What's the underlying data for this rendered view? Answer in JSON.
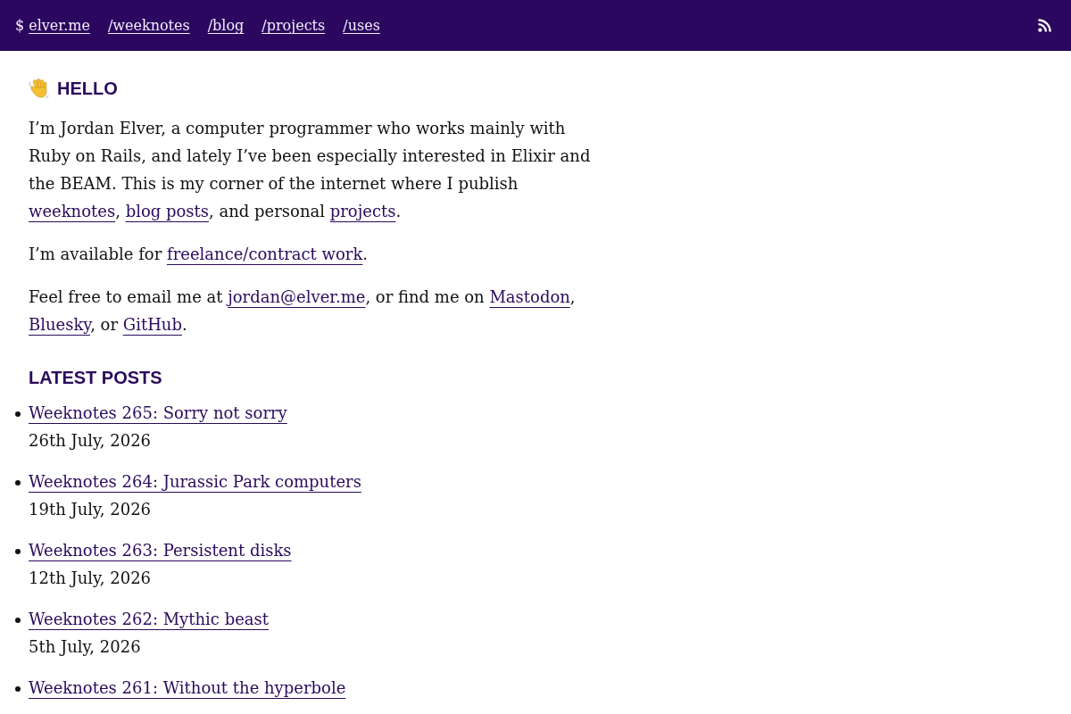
{
  "header": {
    "prompt": "$",
    "site_link": "elver.me",
    "nav_links": [
      "/weeknotes",
      "/blog",
      "/projects",
      "/uses"
    ]
  },
  "hello": {
    "heading": "HELLO",
    "paragraphs": [
      [
        {
          "kind": "text",
          "text": "I’m Jordan Elver, a computer programmer who works mainly with Ruby on Rails, and lately I’ve been especially interested in Elixir and the BEAM. This is my corner of the internet where I publish "
        },
        {
          "kind": "link",
          "text": "weeknotes"
        },
        {
          "kind": "text",
          "text": ", "
        },
        {
          "kind": "link",
          "text": "blog posts"
        },
        {
          "kind": "text",
          "text": ", and personal "
        },
        {
          "kind": "link",
          "text": "projects"
        },
        {
          "kind": "text",
          "text": "."
        }
      ],
      [
        {
          "kind": "text",
          "text": "I’m available for "
        },
        {
          "kind": "link",
          "text": "freelance/contract work"
        },
        {
          "kind": "text",
          "text": "."
        }
      ],
      [
        {
          "kind": "text",
          "text": "Feel free to email me at "
        },
        {
          "kind": "link",
          "text": "jordan@elver.me"
        },
        {
          "kind": "text",
          "text": ", or find me on "
        },
        {
          "kind": "link",
          "text": "Mastodon"
        },
        {
          "kind": "text",
          "text": ", "
        },
        {
          "kind": "link",
          "text": "Bluesky"
        },
        {
          "kind": "text",
          "text": ", or "
        },
        {
          "kind": "link",
          "text": "GitHub"
        },
        {
          "kind": "text",
          "text": "."
        }
      ]
    ]
  },
  "latest_posts": {
    "heading": "LATEST POSTS",
    "posts": [
      {
        "title": "Weeknotes 265: Sorry not sorry",
        "date": "26th July, 2026"
      },
      {
        "title": "Weeknotes 264: Jurassic Park computers",
        "date": "19th July, 2026"
      },
      {
        "title": "Weeknotes 263: Persistent disks",
        "date": "12th July, 2026"
      },
      {
        "title": "Weeknotes 262: Mythic beast",
        "date": "5th July, 2026"
      },
      {
        "title": "Weeknotes 261: Without the hyperbole"
      }
    ]
  }
}
